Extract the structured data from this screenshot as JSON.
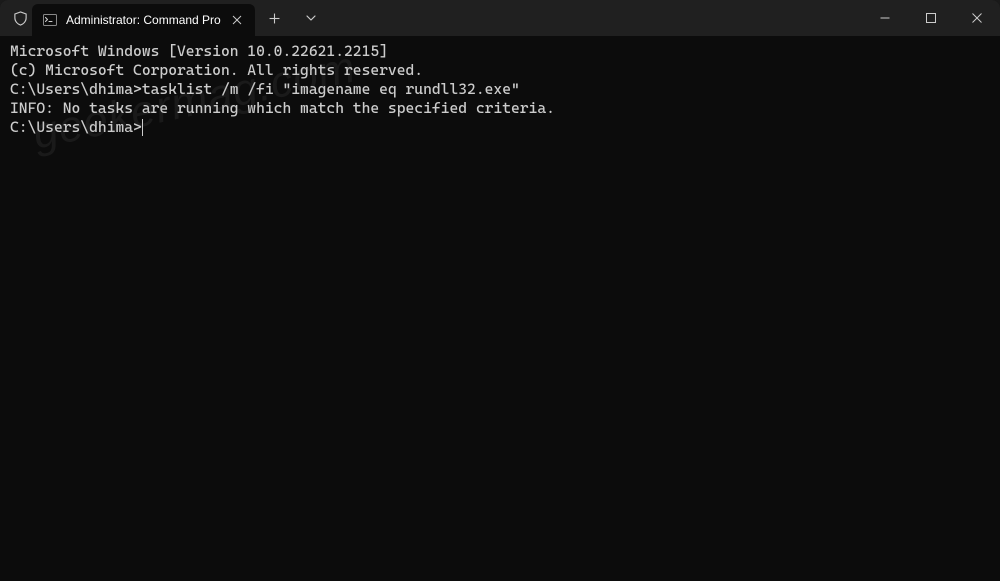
{
  "titlebar": {
    "tab": {
      "title": "Administrator: Command Pro"
    }
  },
  "terminal": {
    "lines": {
      "l0": "Microsoft Windows [Version 10.0.22621.2215]",
      "l1": "(c) Microsoft Corporation. All rights reserved.",
      "l2": "",
      "l3_prompt": "C:\\Users\\dhima>",
      "l3_cmd": "tasklist /m /fi \"imagename eq rundll32.exe\"",
      "l4": "INFO: No tasks are running which match the specified criteria.",
      "l5": "",
      "l6_prompt": "C:\\Users\\dhima>"
    }
  },
  "watermark": "geekermag.com"
}
